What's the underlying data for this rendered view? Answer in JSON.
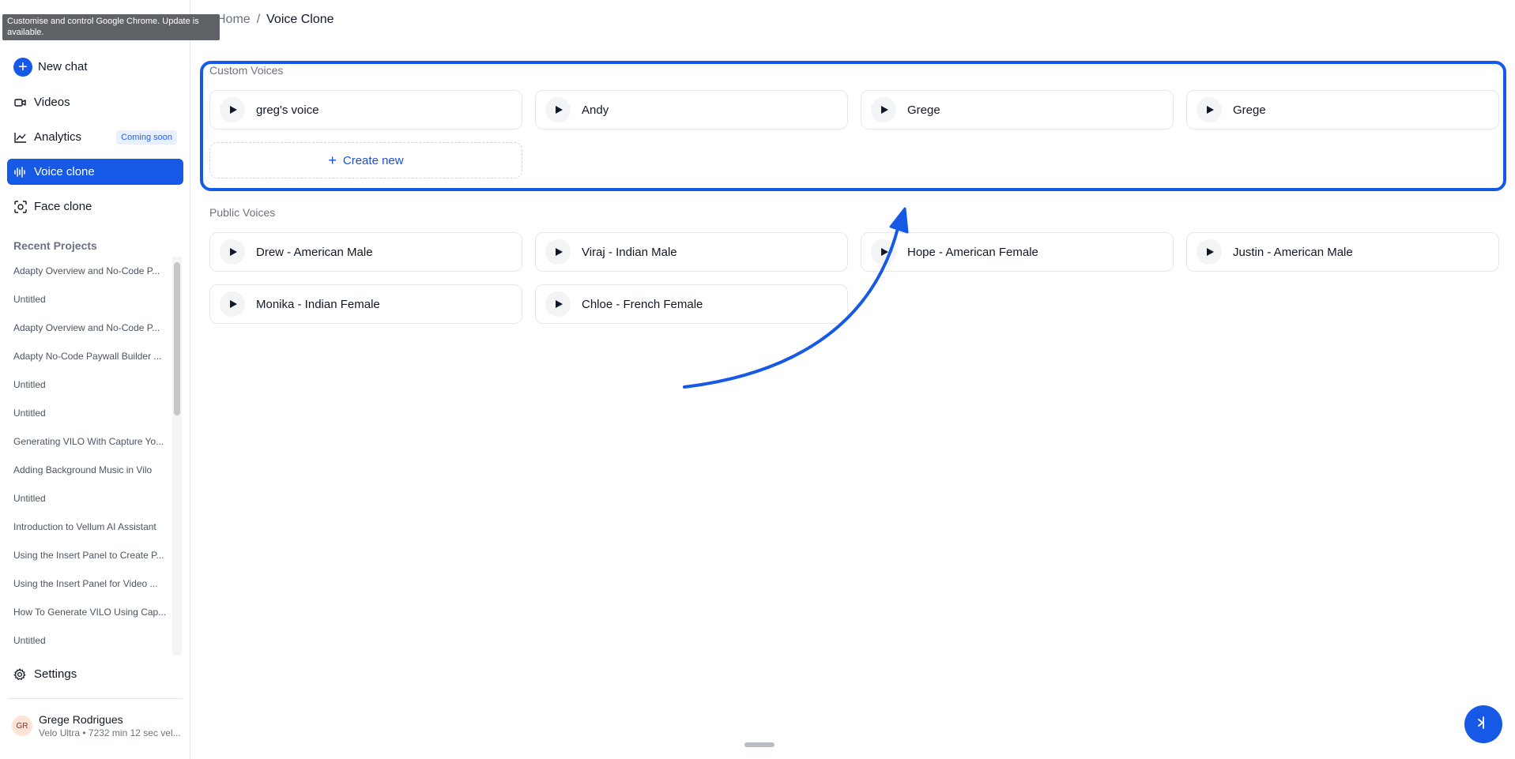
{
  "browser_tooltip": "Customise and control Google Chrome. Update is available.",
  "sidebar": {
    "nav": [
      {
        "label": "New chat",
        "icon": "plus-circle-icon"
      },
      {
        "label": "Videos",
        "icon": "video-camera-icon"
      },
      {
        "label": "Analytics",
        "icon": "line-chart-icon",
        "badge": "Coming soon"
      },
      {
        "label": "Voice clone",
        "icon": "waveform-icon",
        "active": true
      },
      {
        "label": "Face clone",
        "icon": "face-scan-icon"
      }
    ],
    "recent_title": "Recent Projects",
    "recent_projects": [
      "Adapty Overview and No-Code P...",
      "Untitled",
      "Adapty Overview and No-Code P...",
      "Adapty No-Code Paywall Builder ...",
      "Untitled",
      "Untitled",
      "Generating VILO With Capture Yo...",
      "Adding Background Music in Vilo",
      "Untitled",
      "Introduction to Vellum AI Assistant",
      "Using the Insert Panel to Create P...",
      "Using the Insert Panel for Video ...",
      "How To Generate VILO Using Cap...",
      "Untitled"
    ],
    "settings_label": "Settings",
    "user": {
      "initials": "GR",
      "name": "Grege Rodrigues",
      "plan": "Velo Ultra • 7232 min 12 sec vel..."
    }
  },
  "breadcrumb": {
    "home": "Home",
    "separator": "/",
    "current": "Voice Clone"
  },
  "custom_voices": {
    "title": "Custom Voices",
    "items": [
      "greg's voice",
      "Andy",
      "Grege",
      "Grege"
    ],
    "create_label": "Create new"
  },
  "public_voices": {
    "title": "Public Voices",
    "items": [
      "Drew - American Male",
      "Viraj - Indian Male",
      "Hope - American Female",
      "Justin - American Male",
      "Monika - Indian Female",
      "Chloe - French Female"
    ]
  },
  "colors": {
    "accent": "#1559e6",
    "annotation": "#1559e6"
  }
}
